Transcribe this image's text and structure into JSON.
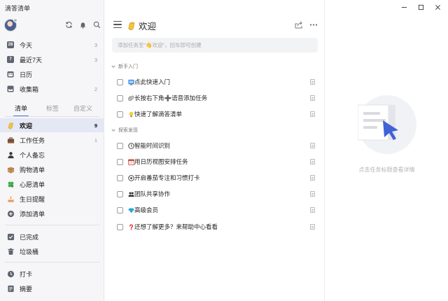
{
  "app": {
    "title": "滴答清单"
  },
  "sidebar": {
    "smart_lists": [
      {
        "name": "今天",
        "count": "3",
        "icon": "calendar-day-icon",
        "badge": "28"
      },
      {
        "name": "最近7天",
        "count": "3",
        "icon": "calendar-week-icon",
        "badge": "7"
      },
      {
        "name": "日历",
        "count": "",
        "icon": "calendar-icon"
      },
      {
        "name": "收集箱",
        "count": "2",
        "icon": "inbox-icon"
      }
    ],
    "tabs": [
      "清单",
      "标签",
      "自定义"
    ],
    "lists": [
      {
        "name": "欢迎",
        "count": "9",
        "icon": "waving-hand-icon",
        "active": true
      },
      {
        "name": "工作任务",
        "count": "1",
        "icon": "briefcase-icon"
      },
      {
        "name": "个人备忘",
        "count": "",
        "icon": "person-icon"
      },
      {
        "name": "购物清单",
        "count": "",
        "icon": "shopping-box-icon"
      },
      {
        "name": "心愿清单",
        "count": "",
        "icon": "clover-icon"
      },
      {
        "name": "生日提醒",
        "count": "",
        "icon": "cake-icon"
      },
      {
        "name": "添加清单",
        "count": "",
        "icon": "plus-circle-icon"
      }
    ],
    "bottom_lists": [
      {
        "name": "已完成",
        "icon": "check-square-icon"
      },
      {
        "name": "垃圾桶",
        "icon": "trash-icon"
      }
    ],
    "tools": [
      {
        "name": "打卡",
        "icon": "clock-icon"
      },
      {
        "name": "摘要",
        "icon": "summary-icon"
      }
    ]
  },
  "main": {
    "title": "欢迎",
    "add_placeholder": "添加任务至\"👋欢迎\"，回车即可创建",
    "sections": [
      {
        "name": "新手入门",
        "tasks": [
          {
            "text": "点此快速入门",
            "icon": "tv-icon"
          },
          {
            "text": "长按右下角➕语音添加任务",
            "icon": "paperclip-icon"
          },
          {
            "text": "快速了解滴答清单",
            "icon": "lightbulb-icon"
          }
        ]
      },
      {
        "name": "探索发现",
        "tasks": [
          {
            "text": "智能时间识别",
            "icon": "clock-icon"
          },
          {
            "text": "用日历视图安排任务",
            "icon": "calendar-icon"
          },
          {
            "text": "开启番茄专注和习惯打卡",
            "icon": "timer-icon"
          },
          {
            "text": "团队共享协作",
            "icon": "team-icon"
          },
          {
            "text": "高级会员",
            "icon": "diamond-icon"
          },
          {
            "text": "还想了解更多？来帮助中心看看",
            "icon": "question-icon"
          }
        ]
      }
    ]
  },
  "detail": {
    "empty_hint": "点击任务标题查看详情"
  },
  "colors": {
    "accent": "#4a74e6",
    "active_bg": "#e4e7f4",
    "sidebar_bg": "#f6f6f8"
  }
}
